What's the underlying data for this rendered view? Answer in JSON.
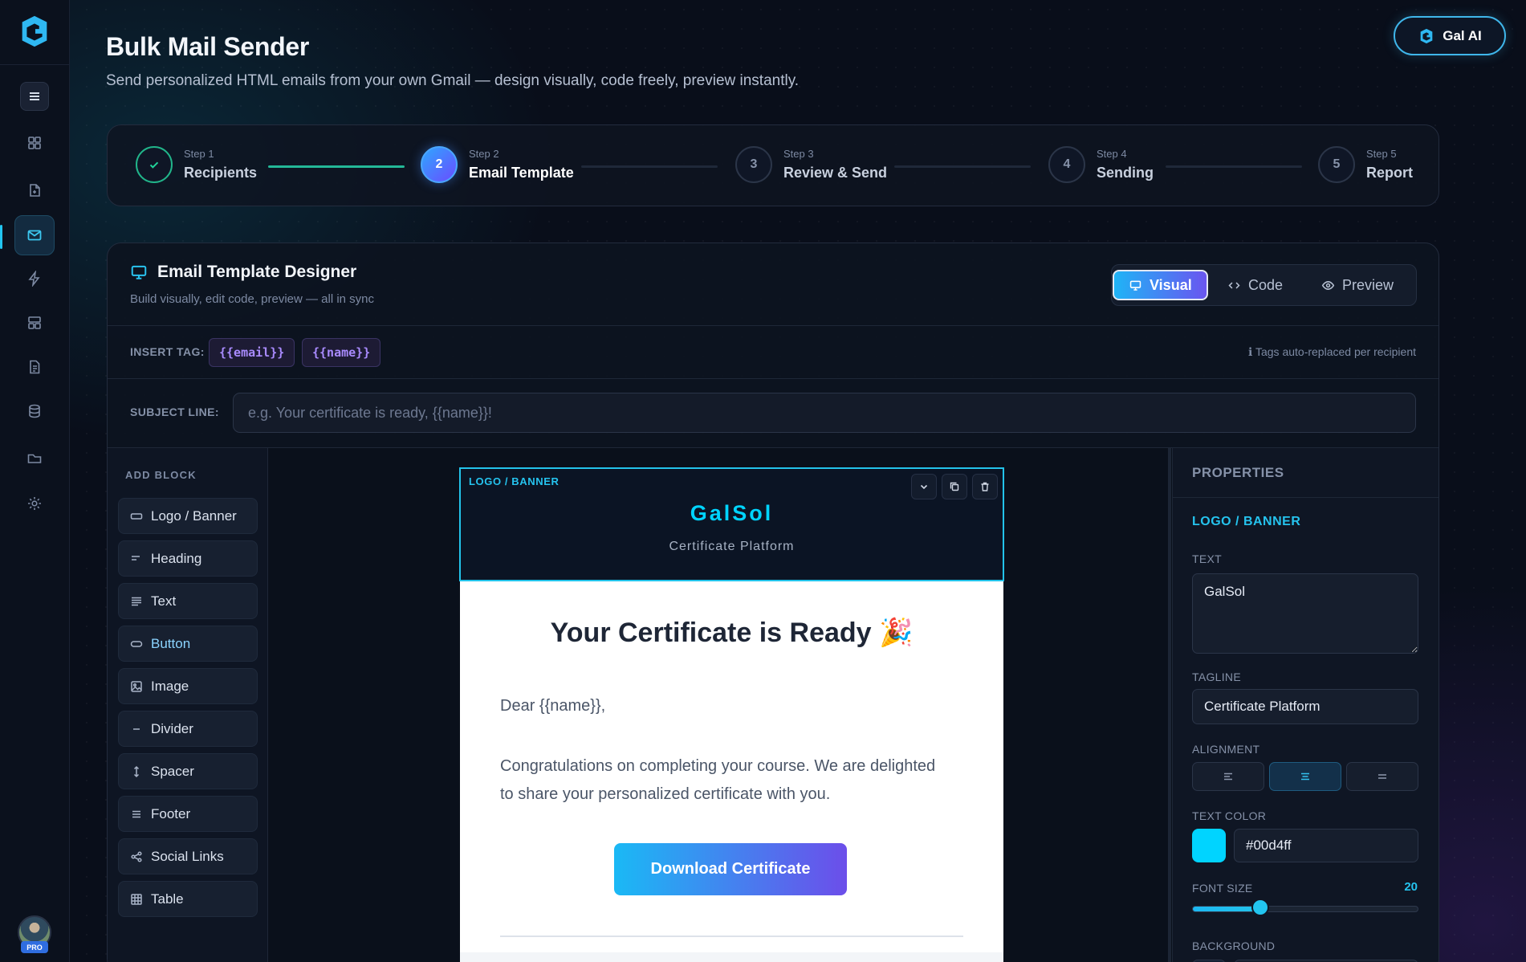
{
  "header": {
    "title": "Bulk Mail Sender",
    "subtitle": "Send personalized HTML emails from your own Gmail — design visually, code freely, preview instantly.",
    "ai_button": "Gal AI"
  },
  "sidebar": {
    "items": [
      "menu-icon",
      "dashboard-icon",
      "document-add-icon",
      "mail-icon",
      "bolt-icon",
      "layout-icon",
      "file-text-icon",
      "database-icon",
      "folder-icon",
      "settings-icon"
    ],
    "active": "mail-icon",
    "badge": "PRO"
  },
  "stepper": {
    "steps": [
      {
        "num": "1",
        "small": "Step 1",
        "name": "Recipients",
        "state": "done"
      },
      {
        "num": "2",
        "small": "Step 2",
        "name": "Email Template",
        "state": "current"
      },
      {
        "num": "3",
        "small": "Step 3",
        "name": "Review & Send",
        "state": "pending"
      },
      {
        "num": "4",
        "small": "Step 4",
        "name": "Sending",
        "state": "pending"
      },
      {
        "num": "5",
        "small": "Step 5",
        "name": "Report",
        "state": "pending"
      }
    ]
  },
  "designer": {
    "title": "Email Template Designer",
    "subtitle": "Build visually, edit code, preview — all in sync",
    "modes": [
      "Visual",
      "Code",
      "Preview"
    ],
    "active_mode": "Visual",
    "insert_tag_label": "INSERT TAG:",
    "tags": [
      "{{email}}",
      "{{name}}"
    ],
    "tag_note": "ℹ Tags auto-replaced per recipient",
    "subject_label": "SUBJECT LINE:",
    "subject_placeholder": "e.g. Your certificate is ready, {{name}}!",
    "subject_value": ""
  },
  "blocks": {
    "label": "ADD BLOCK",
    "items": [
      "Logo / Banner",
      "Heading",
      "Text",
      "Button",
      "Image",
      "Divider",
      "Spacer",
      "Footer",
      "Social Links",
      "Table"
    ]
  },
  "email": {
    "banner_tag": "LOGO / BANNER",
    "banner_text": "GalSol",
    "banner_tagline": "Certificate Platform",
    "heading": "Your Certificate is Ready 🎉",
    "greeting": "Dear {{name}},",
    "body": "Congratulations on completing your course. We are delighted to share your personalized certificate with you.",
    "cta": "Download Certificate"
  },
  "properties": {
    "title": "PROPERTIES",
    "section": "LOGO / BANNER",
    "text_label": "TEXT",
    "text_value": "GalSol",
    "tagline_label": "TAGLINE",
    "tagline_value": "Certificate Platform",
    "alignment_label": "ALIGNMENT",
    "alignment_selected": "center",
    "text_color_label": "TEXT COLOR",
    "text_color_value": "#00d4ff",
    "font_size_label": "FONT SIZE",
    "font_size_value": "20",
    "font_size_fraction": 0.3,
    "background_label": "BACKGROUND"
  },
  "colors": {
    "accent": "#23c3ea",
    "brand_gradient_start": "#1ab9f5",
    "brand_gradient_end": "#6c4eea",
    "banner_text": "#00d4ff"
  }
}
